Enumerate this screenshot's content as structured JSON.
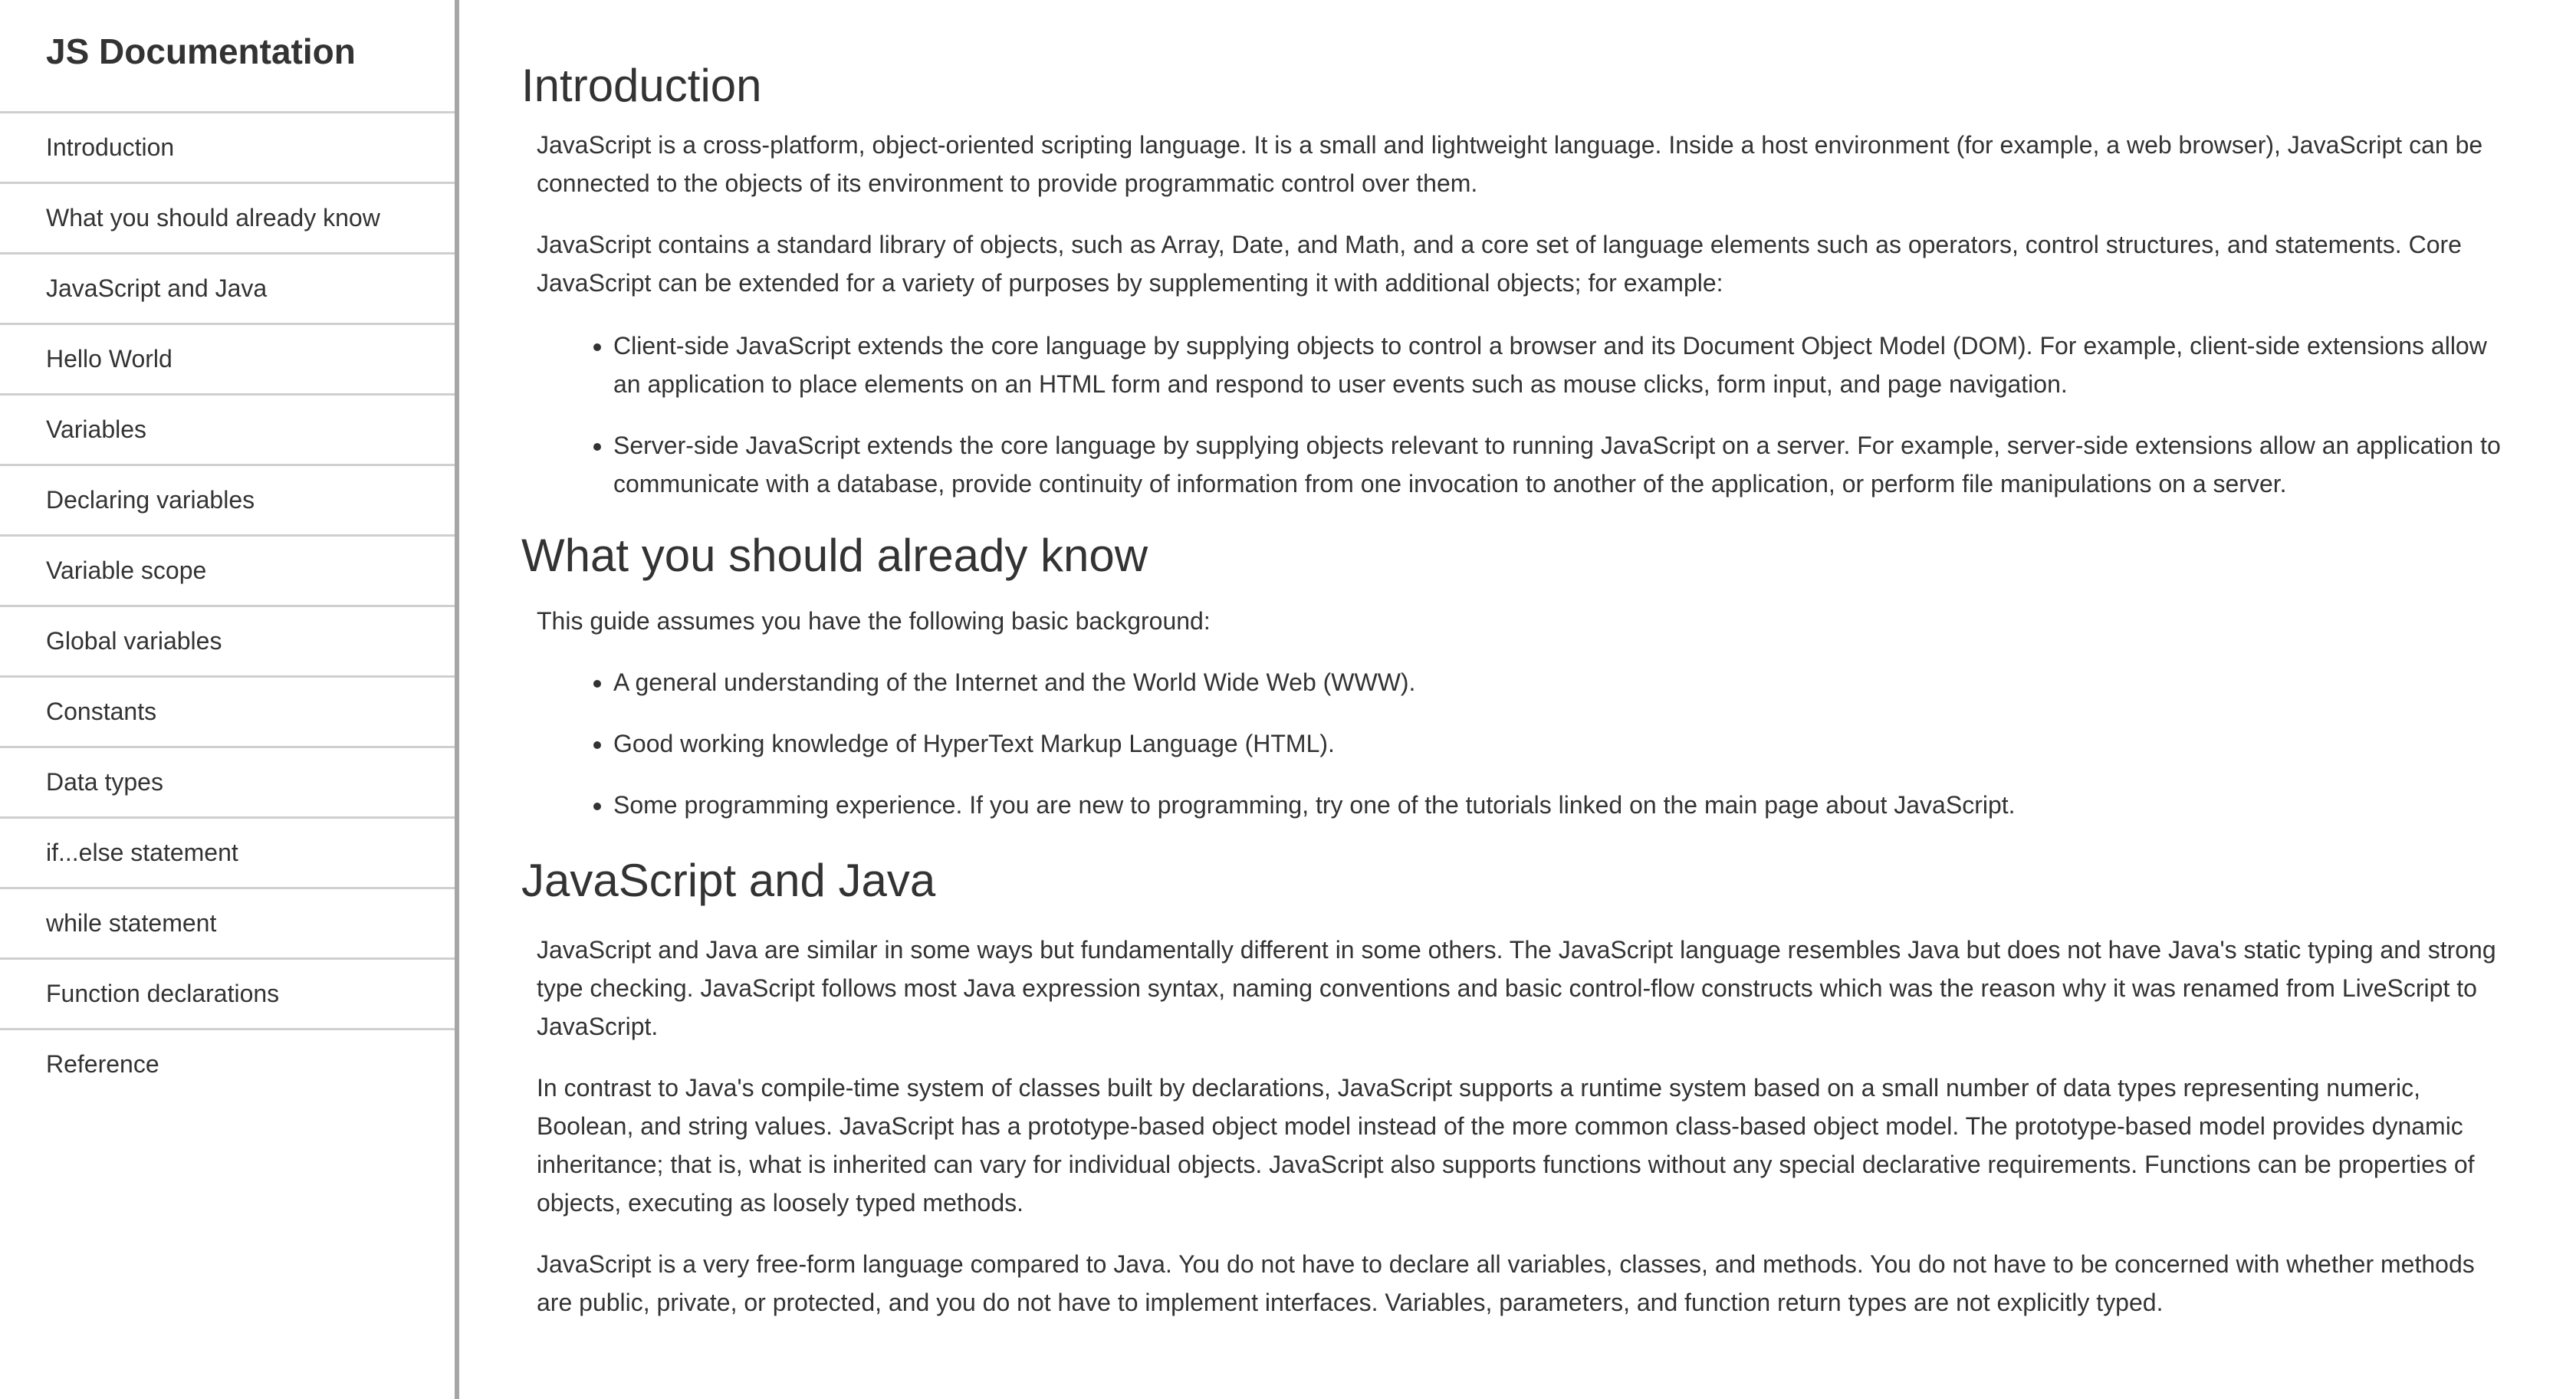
{
  "nav": {
    "title": "JS Documentation",
    "items": [
      {
        "label": "Introduction"
      },
      {
        "label": "What you should already know"
      },
      {
        "label": "JavaScript and Java"
      },
      {
        "label": "Hello World"
      },
      {
        "label": "Variables"
      },
      {
        "label": "Declaring variables"
      },
      {
        "label": "Variable scope"
      },
      {
        "label": "Global variables"
      },
      {
        "label": "Constants"
      },
      {
        "label": "Data types"
      },
      {
        "label": "if...else statement"
      },
      {
        "label": "while statement"
      },
      {
        "label": "Function declarations"
      },
      {
        "label": "Reference"
      }
    ]
  },
  "sections": {
    "introduction": {
      "title": "Introduction",
      "p1": "JavaScript is a cross-platform, object-oriented scripting language. It is a small and lightweight language. Inside a host environment (for example, a web browser), JavaScript can be connected to the objects of its environment to provide programmatic control over them.",
      "p2": "JavaScript contains a standard library of objects, such as Array, Date, and Math, and a core set of language elements such as operators, control structures, and statements. Core JavaScript can be extended for a variety of purposes by supplementing it with additional objects; for example:",
      "bullets": [
        "Client-side JavaScript extends the core language by supplying objects to control a browser and its Document Object Model (DOM). For example, client-side extensions allow an application to place elements on an HTML form and respond to user events such as mouse clicks, form input, and page navigation.",
        "Server-side JavaScript extends the core language by supplying objects relevant to running JavaScript on a server. For example, server-side extensions allow an application to communicate with a database, provide continuity of information from one invocation to another of the application, or perform file manipulations on a server."
      ]
    },
    "already_know": {
      "title": "What you should already know",
      "p1": "This guide assumes you have the following basic background:",
      "bullets": [
        "A general understanding of the Internet and the World Wide Web (WWW).",
        "Good working knowledge of HyperText Markup Language (HTML).",
        "Some programming experience. If you are new to programming, try one of the tutorials linked on the main page about JavaScript."
      ]
    },
    "js_and_java": {
      "title": "JavaScript and Java",
      "p1": "JavaScript and Java are similar in some ways but fundamentally different in some others. The JavaScript language resembles Java but does not have Java's static typing and strong type checking. JavaScript follows most Java expression syntax, naming conventions and basic control-flow constructs which was the reason why it was renamed from LiveScript to JavaScript.",
      "p2": "In contrast to Java's compile-time system of classes built by declarations, JavaScript supports a runtime system based on a small number of data types representing numeric, Boolean, and string values. JavaScript has a prototype-based object model instead of the more common class-based object model. The prototype-based model provides dynamic inheritance; that is, what is inherited can vary for individual objects. JavaScript also supports functions without any special declarative requirements. Functions can be properties of objects, executing as loosely typed methods.",
      "p3": "JavaScript is a very free-form language compared to Java. You do not have to declare all variables, classes, and methods. You do not have to be concerned with whether methods are public, private, or protected, and you do not have to implement interfaces. Variables, parameters, and function return types are not explicitly typed."
    }
  }
}
